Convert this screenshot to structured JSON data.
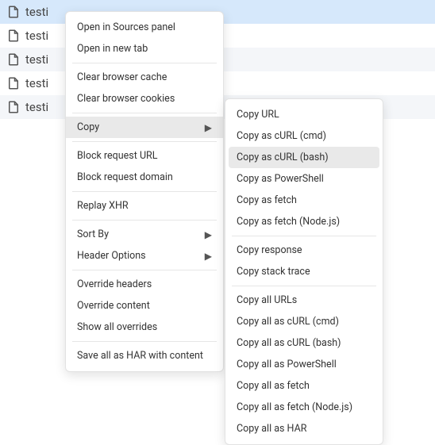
{
  "file_list": {
    "items": [
      {
        "label": "testi"
      },
      {
        "label": "testi"
      },
      {
        "label": "testi"
      },
      {
        "label": "testi"
      },
      {
        "label": "testi"
      }
    ]
  },
  "context_menu": {
    "items": [
      {
        "label": "Open in Sources panel"
      },
      {
        "label": "Open in new tab"
      },
      {
        "separator": true
      },
      {
        "label": "Clear browser cache"
      },
      {
        "label": "Clear browser cookies"
      },
      {
        "separator": true
      },
      {
        "label": "Copy",
        "submenu": true,
        "highlight": true
      },
      {
        "separator": true
      },
      {
        "label": "Block request URL"
      },
      {
        "label": "Block request domain"
      },
      {
        "separator": true
      },
      {
        "label": "Replay XHR"
      },
      {
        "separator": true
      },
      {
        "label": "Sort By",
        "submenu": true
      },
      {
        "label": "Header Options",
        "submenu": true
      },
      {
        "separator": true
      },
      {
        "label": "Override headers"
      },
      {
        "label": "Override content"
      },
      {
        "label": "Show all overrides"
      },
      {
        "separator": true
      },
      {
        "label": "Save all as HAR with content"
      }
    ]
  },
  "copy_submenu": {
    "items": [
      {
        "label": "Copy URL"
      },
      {
        "label": "Copy as cURL (cmd)"
      },
      {
        "label": "Copy as cURL (bash)",
        "highlight": true
      },
      {
        "label": "Copy as PowerShell"
      },
      {
        "label": "Copy as fetch"
      },
      {
        "label": "Copy as fetch (Node.js)"
      },
      {
        "separator": true
      },
      {
        "label": "Copy response"
      },
      {
        "label": "Copy stack trace"
      },
      {
        "separator": true
      },
      {
        "label": "Copy all URLs"
      },
      {
        "label": "Copy all as cURL (cmd)"
      },
      {
        "label": "Copy all as cURL (bash)"
      },
      {
        "label": "Copy all as PowerShell"
      },
      {
        "label": "Copy all as fetch"
      },
      {
        "label": "Copy all as fetch (Node.js)"
      },
      {
        "label": "Copy all as HAR"
      }
    ]
  },
  "icons": {
    "chevron_right": "▶"
  }
}
